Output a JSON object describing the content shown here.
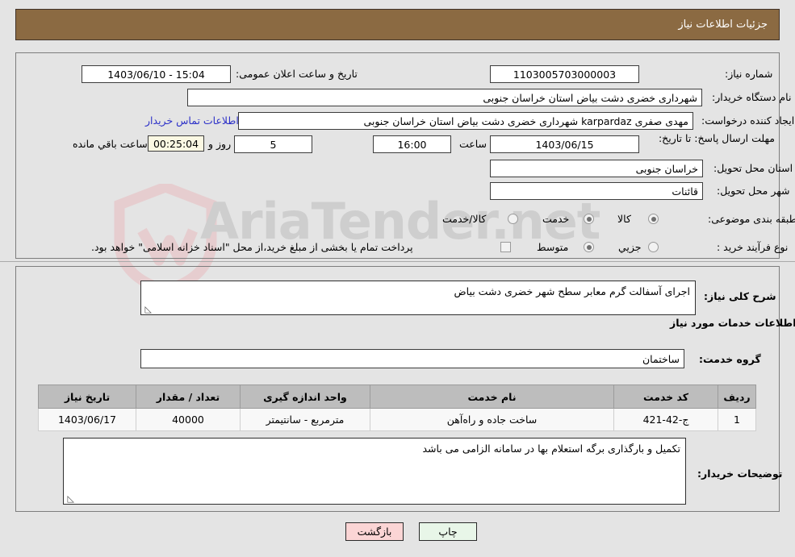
{
  "header": {
    "title": "جزئیات اطلاعات نیاز"
  },
  "watermark": {
    "text": "AriaTender.net",
    "color": "#b9b9b9",
    "shield_color": "#e8b8bb"
  },
  "form": {
    "need_number": {
      "label": "شماره نیاز:",
      "value": "1103005703000003"
    },
    "announce_datetime": {
      "label": "تاریخ و ساعت اعلان عمومی:",
      "value": "15:04 - 1403/06/10"
    },
    "buyer_org": {
      "label": "نام دستگاه خریدار:",
      "value": "شهرداری خضری دشت بیاض استان خراسان جنوبی"
    },
    "creator": {
      "label": "ایجاد کننده درخواست:",
      "value": "مهدی صفری karpardaz شهرداری خضری دشت بیاض استان خراسان جنوبی",
      "contact_link": "اطلاعات تماس خریدار"
    },
    "deadline": {
      "label": "مهلت ارسال پاسخ: تا تاریخ:",
      "date": "1403/06/15",
      "time_label": "ساعت",
      "time": "16:00",
      "days": "5",
      "days_suffix": "روز و",
      "countdown": "00:25:04",
      "countdown_suffix": "ساعت باقي مانده"
    },
    "delivery_province": {
      "label": "استان محل تحویل:",
      "value": "خراسان جنوبی"
    },
    "delivery_city": {
      "label": "شهر محل تحویل:",
      "value": "قائنات"
    },
    "category": {
      "label": "طبقه بندی موضوعی:",
      "options": [
        {
          "label": "کالا",
          "selected": false
        },
        {
          "label": "خدمت",
          "selected": true
        },
        {
          "label": "کالا/خدمت",
          "selected": false
        }
      ]
    },
    "purchase_type": {
      "label": "نوع فرآیند خرید :",
      "options": [
        {
          "label": "جزیي",
          "selected": false
        },
        {
          "label": "متوسط",
          "selected": true
        }
      ],
      "treasury_checkbox": {
        "checked": false,
        "text": "پرداخت تمام یا بخشی از مبلغ خرید،از محل \"اسناد خزانه اسلامی\" خواهد بود."
      }
    },
    "general_description": {
      "label": "شرح کلی نیاز:",
      "value": "اجرای آسفالت گرم معابر سطح شهر خضری دشت بیاض"
    },
    "services_section_title": "اطلاعات خدمات مورد نیاز",
    "service_group": {
      "label": "گروه خدمت:",
      "value": "ساختمان"
    },
    "buyer_notes": {
      "label": "توضیحات خریدار:",
      "value": "تکمیل و بارگذاری برگه استعلام بها در سامانه الزامی می باشد"
    }
  },
  "services_table": {
    "columns": [
      "ردیف",
      "کد خدمت",
      "نام خدمت",
      "واحد اندازه گیری",
      "تعداد / مقدار",
      "تاریخ نیاز"
    ],
    "rows": [
      {
        "row_no": "1",
        "service_code": "ج-42-421",
        "service_name": "ساخت جاده و راه‌آهن",
        "unit": "مترمربع - سانتیمتر",
        "quantity": "40000",
        "need_date": "1403/06/17"
      }
    ]
  },
  "buttons": {
    "print": "چاپ",
    "back": "بازگشت"
  }
}
